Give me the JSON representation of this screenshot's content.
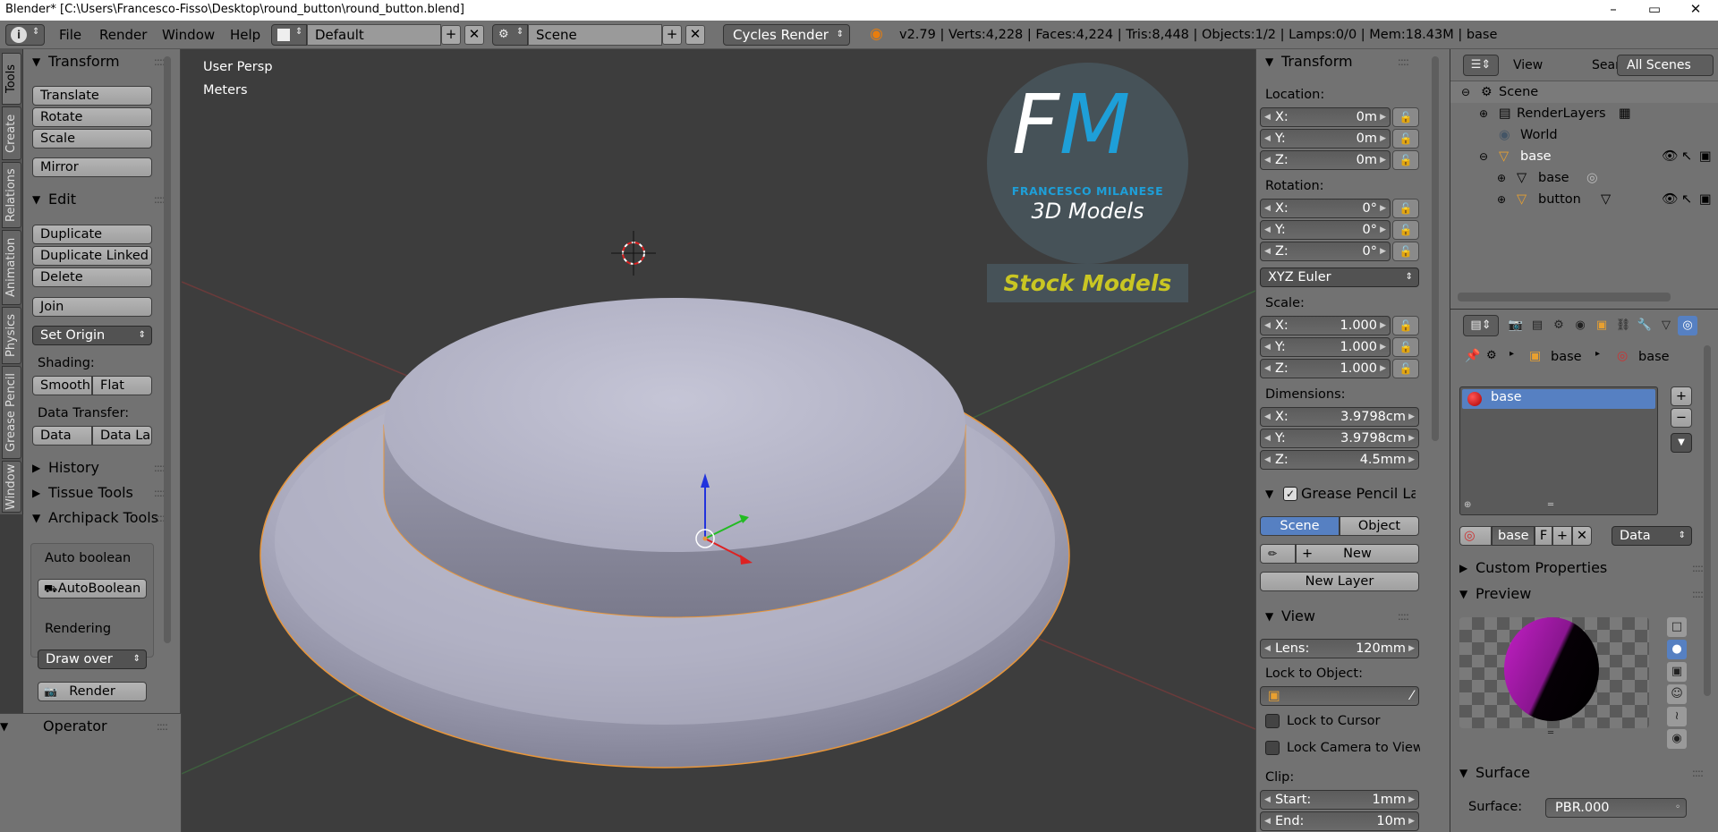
{
  "window": {
    "title": "Blender* [C:\\Users\\Francesco-Fisso\\Desktop\\round_button\\round_button.blend]",
    "minimize": "–",
    "maximize": "▭",
    "close": "✕"
  },
  "menu": {
    "info_icon": "i",
    "file": "File",
    "render": "Render",
    "window": "Window",
    "help": "Help",
    "layout": "Default",
    "scene": "Scene",
    "engine": "Cycles Render",
    "stats": "v2.79 | Verts:4,228 | Faces:4,224 | Tris:8,448 | Objects:1/2 | Lamps:0/0 | Mem:18.43M | base"
  },
  "tabs": [
    "Tools",
    "Create",
    "Relations",
    "Animation",
    "Physics",
    "Grease Pencil",
    "Window"
  ],
  "toolshelf": {
    "transform": {
      "title": "Transform",
      "translate": "Translate",
      "rotate": "Rotate",
      "scale": "Scale",
      "mirror": "Mirror"
    },
    "edit": {
      "title": "Edit",
      "duplicate": "Duplicate",
      "duplicate_linked": "Duplicate Linked",
      "delete": "Delete",
      "join": "Join",
      "set_origin": "Set Origin",
      "shading": "Shading:",
      "smooth": "Smooth",
      "flat": "Flat",
      "data_transfer": "Data Transfer:",
      "data": "Data",
      "data_la": "Data La"
    },
    "history": "History",
    "tissue": "Tissue Tools",
    "archipack": "Archipack Tools",
    "auto_boolean_lbl": "Auto boolean",
    "auto_boolean_btn": "AutoBoolean",
    "rendering": "Rendering",
    "draw_over": "Draw over",
    "render": "Render",
    "operator": "Operator"
  },
  "viewport": {
    "persp": "User Persp",
    "units": "Meters",
    "logo_letters": "FM",
    "logo_name": "FRANCESCO MILANESE",
    "logo_sub": "3D Models",
    "stock": "Stock Models"
  },
  "npanel": {
    "transform": "Transform",
    "location": "Location:",
    "loc": [
      {
        "k": "X:",
        "v": "0m"
      },
      {
        "k": "Y:",
        "v": "0m"
      },
      {
        "k": "Z:",
        "v": "0m"
      }
    ],
    "rotation": "Rotation:",
    "rot": [
      {
        "k": "X:",
        "v": "0°"
      },
      {
        "k": "Y:",
        "v": "0°"
      },
      {
        "k": "Z:",
        "v": "0°"
      }
    ],
    "euler": "XYZ Euler",
    "scale": "Scale:",
    "sc": [
      {
        "k": "X:",
        "v": "1.000"
      },
      {
        "k": "Y:",
        "v": "1.000"
      },
      {
        "k": "Z:",
        "v": "1.000"
      }
    ],
    "dimensions": "Dimensions:",
    "dim": [
      {
        "k": "X:",
        "v": "3.9798cm"
      },
      {
        "k": "Y:",
        "v": "3.9798cm"
      },
      {
        "k": "Z:",
        "v": "4.5mm"
      }
    ],
    "gp_title": "Grease Pencil Layer",
    "gp_scene": "Scene",
    "gp_object": "Object",
    "gp_new": "New",
    "gp_new_layer": "New Layer",
    "view": "View",
    "lens_k": "Lens:",
    "lens_v": "120mm",
    "lock_obj": "Lock to Object:",
    "lock_cursor": "Lock to Cursor",
    "lock_camera": "Lock Camera to View",
    "clip": "Clip:",
    "start_k": "Start:",
    "start_v": "1mm",
    "end_k": "End:",
    "end_v": "10m"
  },
  "outliner": {
    "view": "View",
    "search": "Search",
    "scenes": "All Scenes",
    "rows": [
      "Scene",
      "RenderLayers",
      "World",
      "base",
      "base",
      "button"
    ]
  },
  "props": {
    "bc_base1": "base",
    "bc_base2": "base",
    "slot": "base",
    "mat_name": "base",
    "mat_f": "F",
    "data": "Data",
    "custom": "Custom Properties",
    "preview": "Preview",
    "surface_hdr": "Surface",
    "surface_lbl": "Surface:",
    "surface_val": "PBR.000"
  },
  "colors": {
    "accent": "#5680c2",
    "logo_blue": "#1e9fd8",
    "stock_yellow": "#c9c623",
    "selection": "#f0a040"
  }
}
